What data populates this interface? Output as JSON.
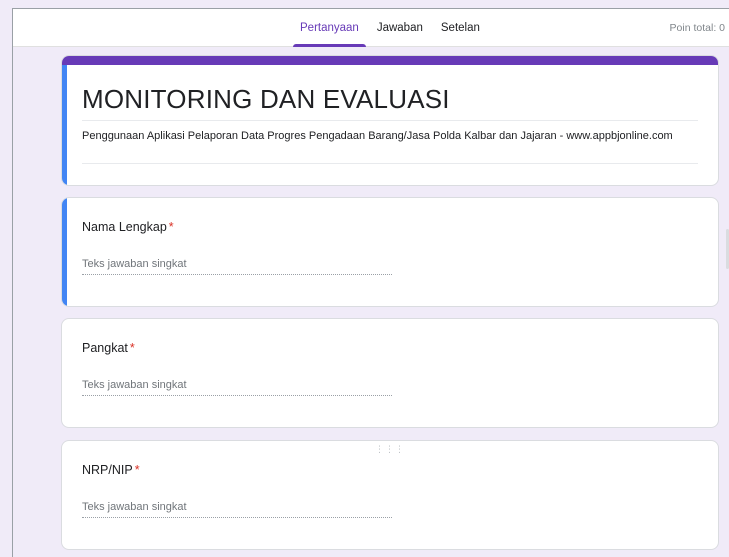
{
  "header": {
    "tabs": [
      {
        "label": "Pertanyaan",
        "active": true
      },
      {
        "label": "Jawaban",
        "active": false
      },
      {
        "label": "Setelan",
        "active": false
      }
    ],
    "points_label": "Poin total: 0"
  },
  "form": {
    "title": "MONITORING DAN EVALUASI",
    "description": "Penggunaan Aplikasi Pelaporan Data Progres Pengadaan Barang/Jasa Polda Kalbar dan Jajaran - www.appbjonline.com"
  },
  "questions": [
    {
      "title": "Nama Lengkap",
      "required_mark": "*",
      "answer_placeholder": "Teks jawaban singkat"
    },
    {
      "title": "Pangkat",
      "required_mark": "*",
      "answer_placeholder": "Teks jawaban singkat"
    },
    {
      "title": "NRP/NIP",
      "required_mark": "*",
      "answer_placeholder": "Teks jawaban singkat"
    }
  ],
  "colors": {
    "accent": "#673ab7",
    "selected_border": "#4285f4",
    "background": "#f0ebf8",
    "required": "#d93025"
  }
}
